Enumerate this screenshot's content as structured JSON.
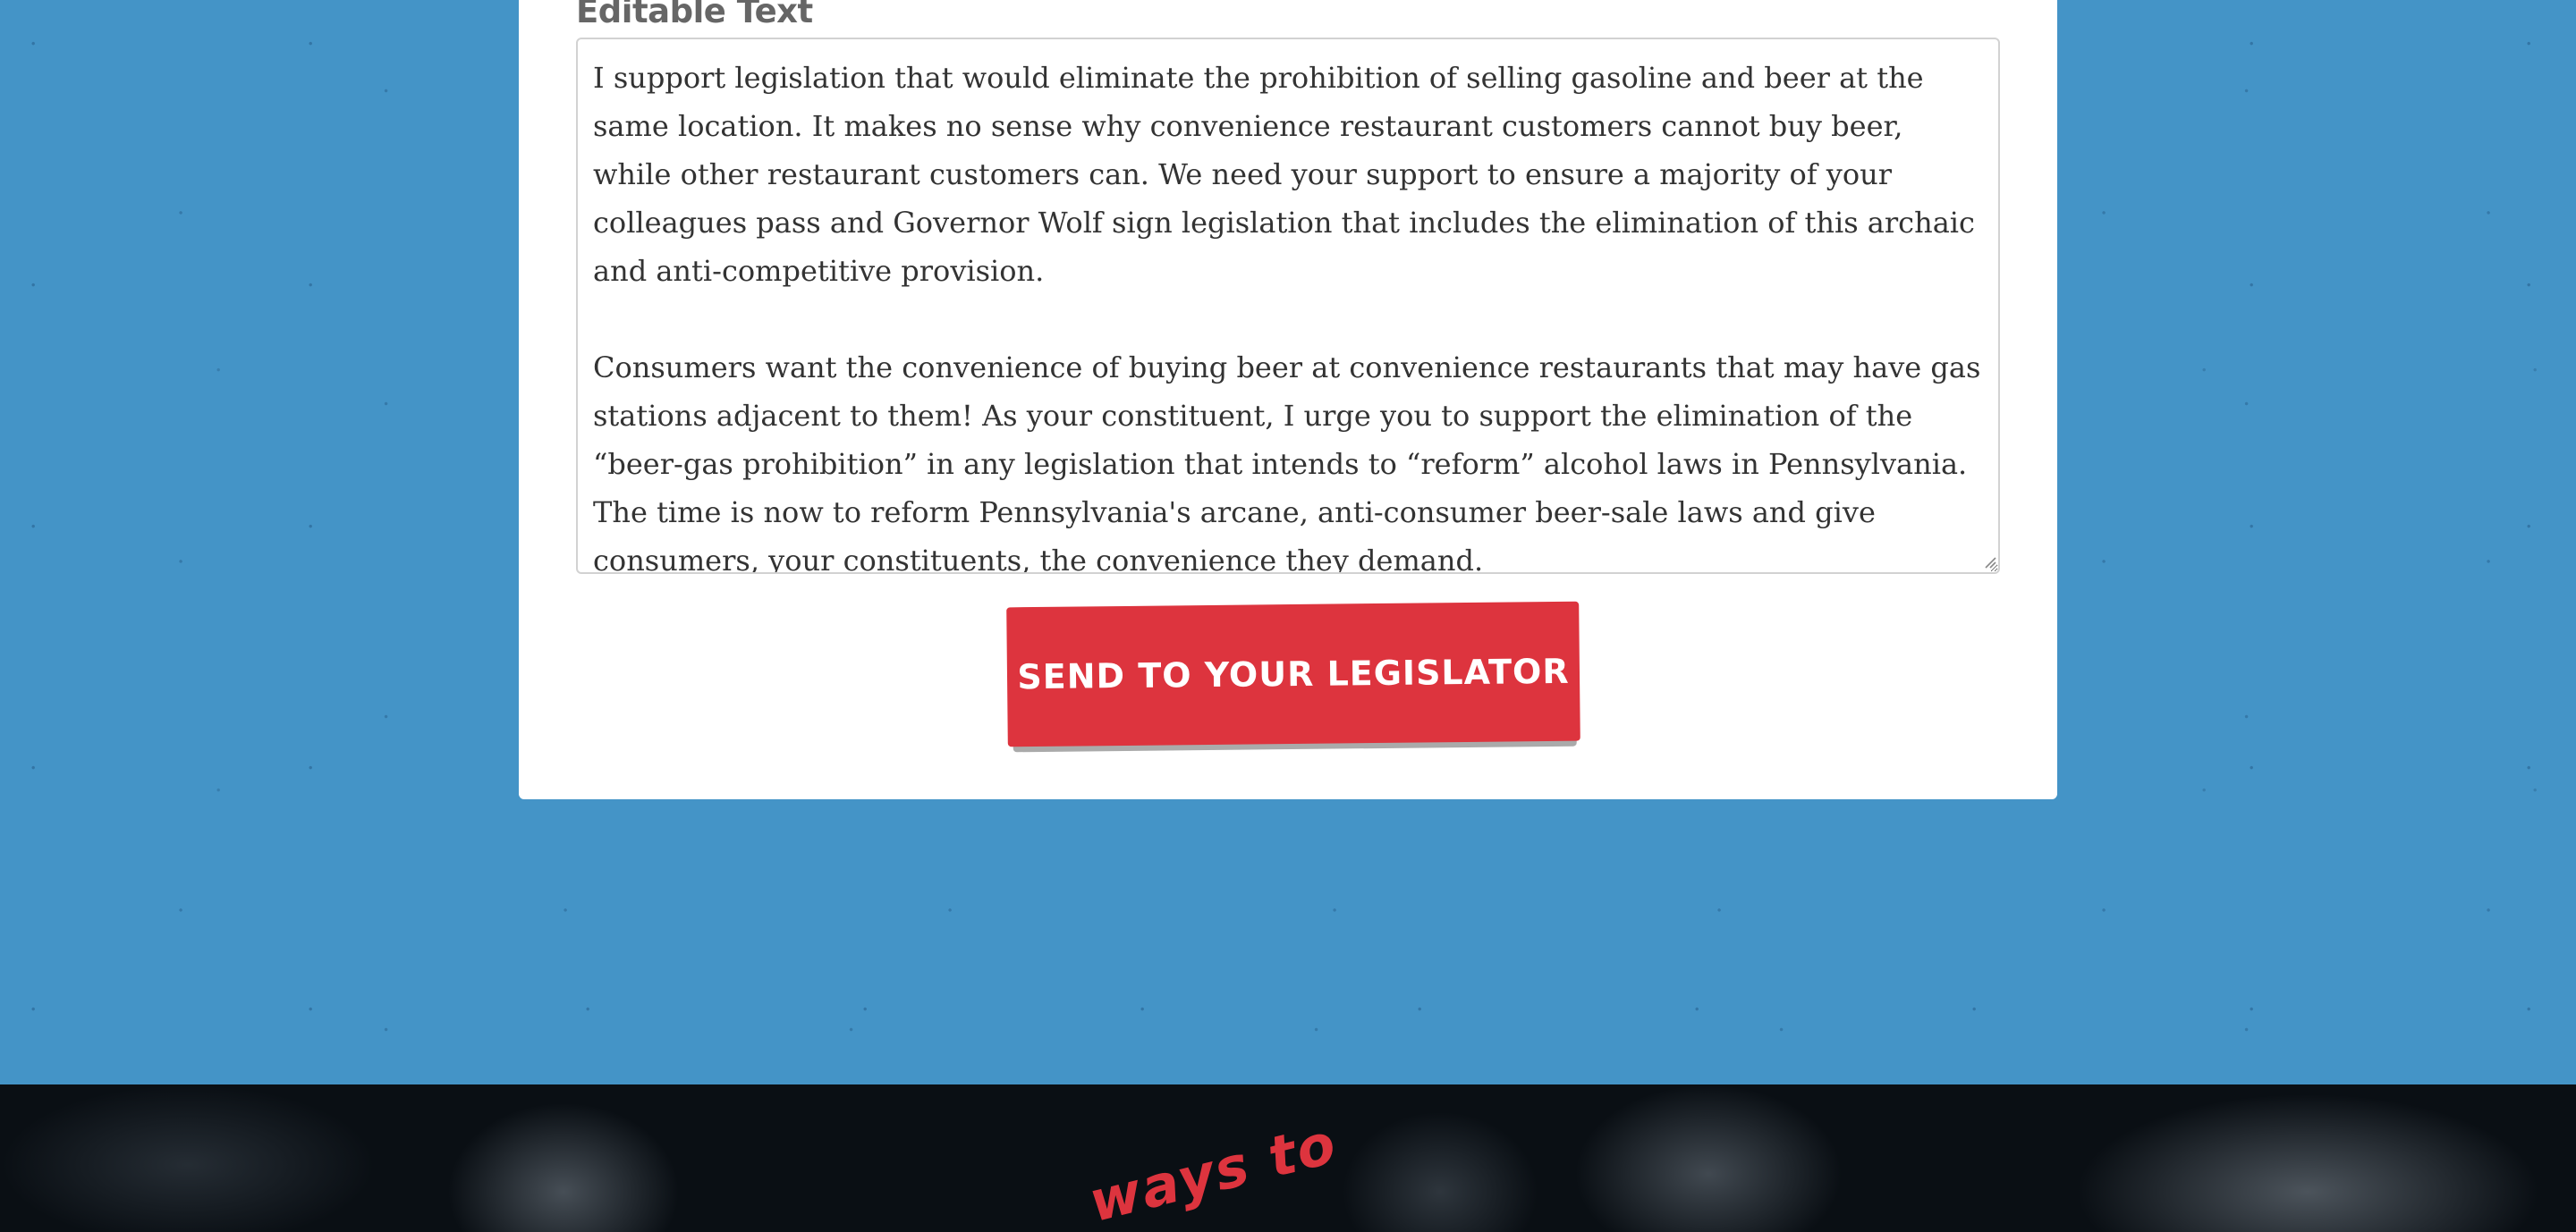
{
  "form": {
    "field_label": "Editable Text",
    "message_body": "I support legislation that would eliminate the prohibition of selling gasoline and beer at the same location. It makes no sense why convenience restaurant customers cannot buy beer, while other restaurant customers can. We need your support to ensure a majority of your colleagues pass and Governor Wolf sign legislation that includes the elimination of this archaic and anti-competitive provision.\n\nConsumers want the convenience of buying beer at convenience restaurants that may have gas stations adjacent to them! As your constituent, I urge you to support the elimination of the “beer-gas prohibition” in any legislation that intends to “reform” alcohol laws in Pennsylvania. The time is now to reform Pennsylvania's arcane, anti-consumer beer-sale laws and give consumers, your constituents, the convenience they demand.",
    "submit_label": "SEND TO YOUR LEGISLATOR"
  },
  "footer": {
    "script_text": "ways to"
  },
  "colors": {
    "page_background": "#4494c7",
    "card_background": "#ffffff",
    "button_red": "#dd343e",
    "footer_dark": "#0a0f14"
  },
  "icons": {
    "resize_grip": "resize-handle-icon"
  }
}
